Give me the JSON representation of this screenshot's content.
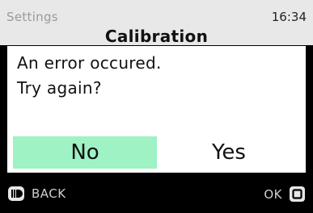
{
  "header": {
    "breadcrumb": "Settings",
    "time": "16:34",
    "title": "Calibration"
  },
  "dialog": {
    "lines": [
      "An error occured.",
      "Try again?"
    ],
    "no_label": "No",
    "yes_label": "Yes",
    "selected": "No"
  },
  "footer": {
    "back_label": "BACK",
    "ok_label": "OK",
    "back_icon": "back-button-icon",
    "ok_icon": "ok-button-icon"
  },
  "colors": {
    "header_bg": "#e8e8e8",
    "selected_bg": "#9ef2c4",
    "footer_bg": "#000000"
  }
}
